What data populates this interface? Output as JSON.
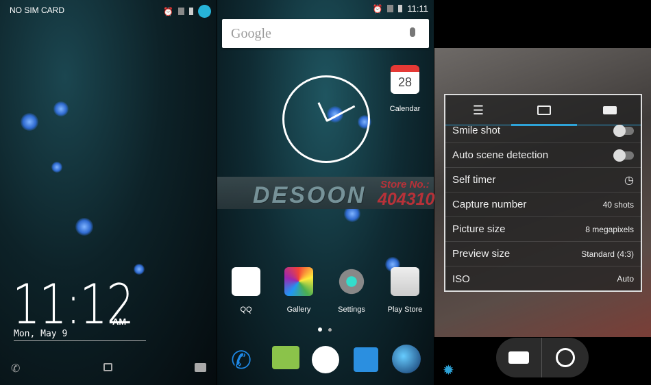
{
  "lockscreen": {
    "carrier": "NO SIM CARD",
    "time": "11:12",
    "ampm": "AM",
    "date": "Mon, May 9",
    "icons": [
      "alarm-icon",
      "no-sim-icon",
      "battery-icon",
      "user-avatar-icon"
    ],
    "shortcuts": [
      "phone-icon",
      "unlock-icon",
      "camera-icon"
    ]
  },
  "home": {
    "status_time": "11:11",
    "search": {
      "placeholder": "Google"
    },
    "calendar": {
      "day": "28",
      "label": "Calendar"
    },
    "apps": [
      {
        "label": "QQ"
      },
      {
        "label": "Gallery"
      },
      {
        "label": "Settings"
      },
      {
        "label": "Play Store"
      }
    ],
    "dock": [
      "phone-icon",
      "messaging-icon",
      "app-drawer-icon",
      "contacts-icon",
      "browser-icon"
    ]
  },
  "watermark": {
    "brand": "DESOON",
    "store_label": "Store No.:",
    "store_number": "404310"
  },
  "camera": {
    "tabs": [
      "settings-sliders-icon",
      "camera-icon",
      "video-icon"
    ],
    "active_tab": 1,
    "settings": [
      {
        "label": "Smile shot",
        "type": "toggle",
        "value": "off"
      },
      {
        "label": "Auto scene detection",
        "type": "toggle",
        "value": "off"
      },
      {
        "label": "Self timer",
        "type": "icon"
      },
      {
        "label": "Capture number",
        "value": "40 shots"
      },
      {
        "label": "Picture size",
        "value": "8 megapixels"
      },
      {
        "label": "Preview size",
        "value": "Standard (4:3)"
      },
      {
        "label": "ISO",
        "value": "Auto"
      }
    ],
    "accent": "#2ea3d8"
  }
}
